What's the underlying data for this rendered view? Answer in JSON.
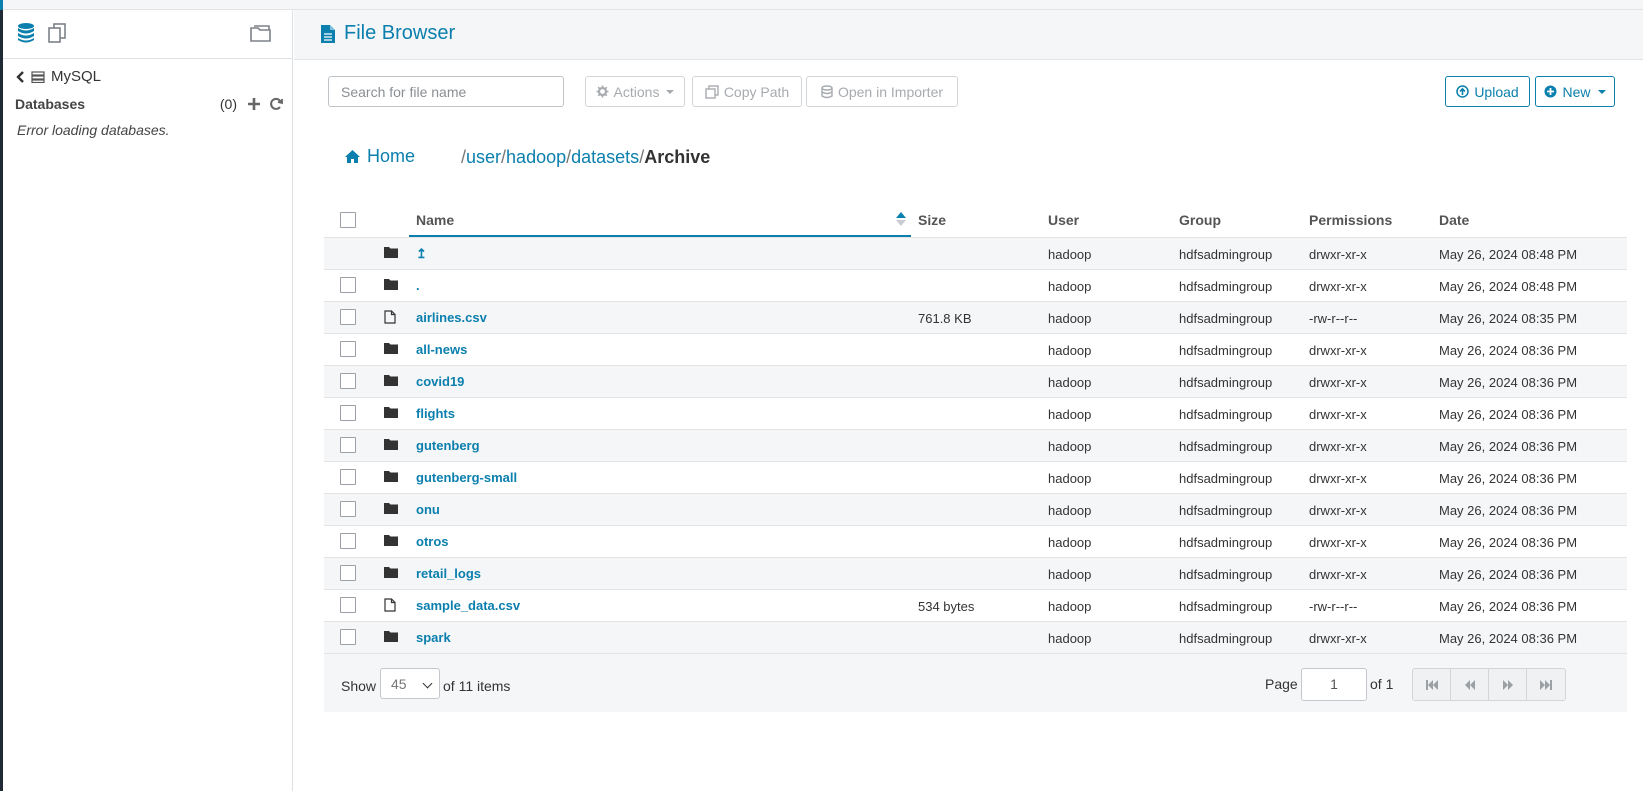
{
  "sidebar": {
    "db_name": "MySQL",
    "databases_label": "Databases",
    "databases_count": "(0)",
    "error_text": "Error loading databases."
  },
  "header": {
    "title": "File Browser"
  },
  "toolbar": {
    "search_placeholder": "Search for file name",
    "actions_label": "Actions",
    "copy_path_label": "Copy Path",
    "open_importer_label": "Open in Importer",
    "upload_label": "Upload",
    "new_label": "New"
  },
  "breadcrumb": {
    "home_label": "Home",
    "parts": [
      "user",
      "hadoop",
      "datasets"
    ],
    "current": "Archive",
    "separator": "/"
  },
  "table": {
    "columns": {
      "name": "Name",
      "size": "Size",
      "user": "User",
      "group": "Group",
      "permissions": "Permissions",
      "date": "Date"
    },
    "rows": [
      {
        "icon": "folder",
        "name": "↥",
        "size": "",
        "user": "hadoop",
        "group": "hdfsadmingroup",
        "permissions": "drwxr-xr-x",
        "date": "May 26, 2024 08:48 PM",
        "checkbox": false
      },
      {
        "icon": "folder",
        "name": ".",
        "size": "",
        "user": "hadoop",
        "group": "hdfsadmingroup",
        "permissions": "drwxr-xr-x",
        "date": "May 26, 2024 08:48 PM",
        "checkbox": true
      },
      {
        "icon": "file",
        "name": "airlines.csv",
        "size": "761.8 KB",
        "user": "hadoop",
        "group": "hdfsadmingroup",
        "permissions": "-rw-r--r--",
        "date": "May 26, 2024 08:35 PM",
        "checkbox": true
      },
      {
        "icon": "folder",
        "name": "all-news",
        "size": "",
        "user": "hadoop",
        "group": "hdfsadmingroup",
        "permissions": "drwxr-xr-x",
        "date": "May 26, 2024 08:36 PM",
        "checkbox": true
      },
      {
        "icon": "folder",
        "name": "covid19",
        "size": "",
        "user": "hadoop",
        "group": "hdfsadmingroup",
        "permissions": "drwxr-xr-x",
        "date": "May 26, 2024 08:36 PM",
        "checkbox": true
      },
      {
        "icon": "folder",
        "name": "flights",
        "size": "",
        "user": "hadoop",
        "group": "hdfsadmingroup",
        "permissions": "drwxr-xr-x",
        "date": "May 26, 2024 08:36 PM",
        "checkbox": true
      },
      {
        "icon": "folder",
        "name": "gutenberg",
        "size": "",
        "user": "hadoop",
        "group": "hdfsadmingroup",
        "permissions": "drwxr-xr-x",
        "date": "May 26, 2024 08:36 PM",
        "checkbox": true
      },
      {
        "icon": "folder",
        "name": "gutenberg-small",
        "size": "",
        "user": "hadoop",
        "group": "hdfsadmingroup",
        "permissions": "drwxr-xr-x",
        "date": "May 26, 2024 08:36 PM",
        "checkbox": true
      },
      {
        "icon": "folder",
        "name": "onu",
        "size": "",
        "user": "hadoop",
        "group": "hdfsadmingroup",
        "permissions": "drwxr-xr-x",
        "date": "May 26, 2024 08:36 PM",
        "checkbox": true
      },
      {
        "icon": "folder",
        "name": "otros",
        "size": "",
        "user": "hadoop",
        "group": "hdfsadmingroup",
        "permissions": "drwxr-xr-x",
        "date": "May 26, 2024 08:36 PM",
        "checkbox": true
      },
      {
        "icon": "folder",
        "name": "retail_logs",
        "size": "",
        "user": "hadoop",
        "group": "hdfsadmingroup",
        "permissions": "drwxr-xr-x",
        "date": "May 26, 2024 08:36 PM",
        "checkbox": true
      },
      {
        "icon": "file",
        "name": "sample_data.csv",
        "size": "534 bytes",
        "user": "hadoop",
        "group": "hdfsadmingroup",
        "permissions": "-rw-r--r--",
        "date": "May 26, 2024 08:36 PM",
        "checkbox": true
      },
      {
        "icon": "folder",
        "name": "spark",
        "size": "",
        "user": "hadoop",
        "group": "hdfsadmingroup",
        "permissions": "drwxr-xr-x",
        "date": "May 26, 2024 08:36 PM",
        "checkbox": true
      }
    ]
  },
  "footer": {
    "show_label": "Show",
    "page_size": "45",
    "items_label": "of 11 items",
    "page_label": "Page",
    "page_value": "1",
    "page_of": "of 1"
  },
  "colors": {
    "accent": "#0b7fad",
    "stripe": "#f5f6f7"
  }
}
